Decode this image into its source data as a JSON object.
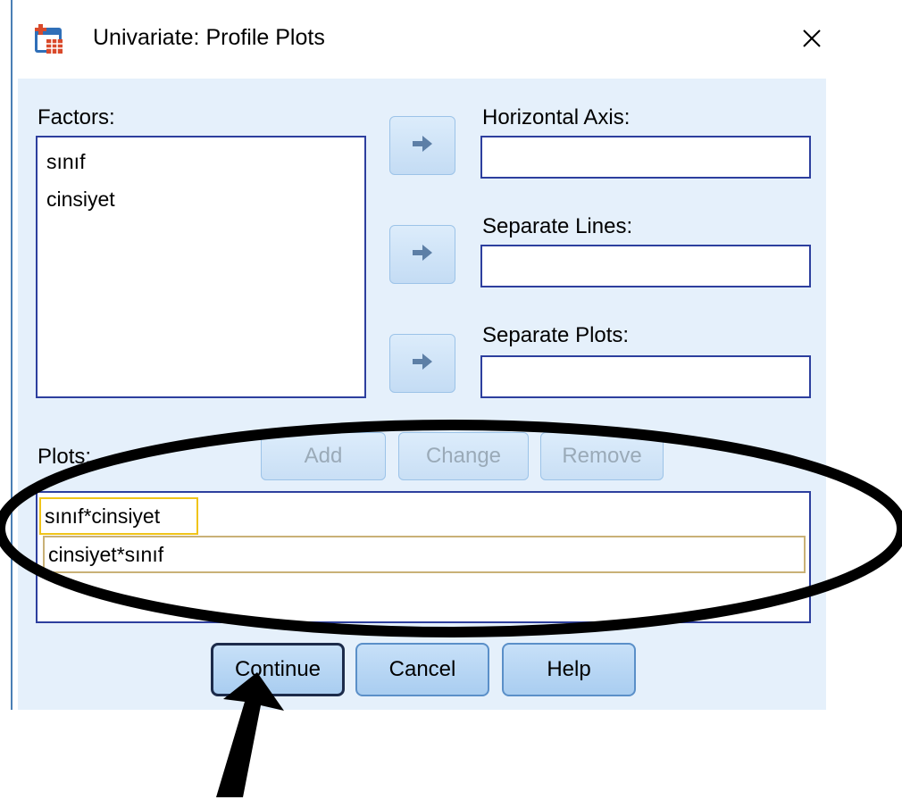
{
  "window": {
    "title": "Univariate: Profile Plots",
    "icon": "spss-chart-icon",
    "close_icon": "close-icon"
  },
  "factors": {
    "label": "Factors:",
    "items": [
      "sınıf",
      "cinsiyet"
    ]
  },
  "targets": {
    "horizontal_axis": {
      "label": "Horizontal Axis:",
      "value": ""
    },
    "separate_lines": {
      "label": "Separate Lines:",
      "value": ""
    },
    "separate_plots": {
      "label": "Separate Plots:",
      "value": ""
    }
  },
  "plots": {
    "label": "Plots:",
    "buttons": {
      "add": "Add",
      "change": "Change",
      "remove": "Remove"
    },
    "items": [
      "sınıf*cinsiyet",
      "cinsiyet*sınıf"
    ]
  },
  "footer": {
    "continue": "Continue",
    "cancel": "Cancel",
    "help": "Help"
  },
  "colors": {
    "client_bg": "#e5f0fb",
    "list_border": "#2d3f9e",
    "annotation": "#000000"
  }
}
